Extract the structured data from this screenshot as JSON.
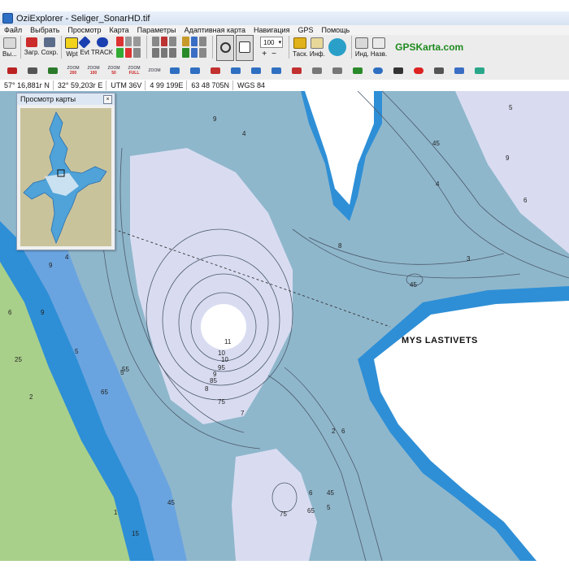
{
  "window": {
    "title": "OziExplorer - Seliger_SonarHD.tif"
  },
  "menu": [
    "Файл",
    "Выбрать",
    "Просмотр",
    "Карта",
    "Параметры",
    "Адаптивная карта",
    "Навигация",
    "GPS",
    "Помощь"
  ],
  "toolbar": {
    "exit_label": "Вы...",
    "load_label": "Загр.",
    "save_label": "Сохр.",
    "wpt_label": "Wpt",
    "evt_label": "Evt",
    "track_label": "TRACK",
    "zoom_value": "100",
    "task_label": "Таск.",
    "info_label": "Инф.",
    "ind_label": "Инд.",
    "name_label": "Назв.",
    "brand": "GPSKarta.com"
  },
  "toolbar2": {
    "zoom_buttons": [
      {
        "top": "ZOOM",
        "bottom": "200"
      },
      {
        "top": "ZOOM",
        "bottom": "100"
      },
      {
        "top": "ZOOM",
        "bottom": "50"
      },
      {
        "top": "ZOOM",
        "bottom": "FULL"
      },
      {
        "top": "ZOOM",
        "bottom": ""
      }
    ]
  },
  "status": {
    "lat": "57° 16,881г N",
    "lon": "32° 59,203г E",
    "utm": "UTM  36V",
    "easting": "4 99 199E",
    "northing": "63 48 705N",
    "datum": "WGS 84"
  },
  "preview": {
    "title": "Просмотр карты"
  },
  "map": {
    "place_label": "MYS LASTIVETS",
    "depths": [
      "9",
      "4",
      "9",
      "45",
      "9",
      "6",
      "5",
      "3",
      "4",
      "45",
      "8",
      "9",
      "4",
      "5",
      "6",
      "9",
      "25",
      "2",
      "5",
      "65",
      "55",
      "11",
      "10",
      "10",
      "95",
      "9",
      "85",
      "8",
      "75",
      "7",
      "2",
      "6",
      "6",
      "45",
      "5",
      "75",
      "65",
      "45",
      "1",
      "15"
    ]
  }
}
